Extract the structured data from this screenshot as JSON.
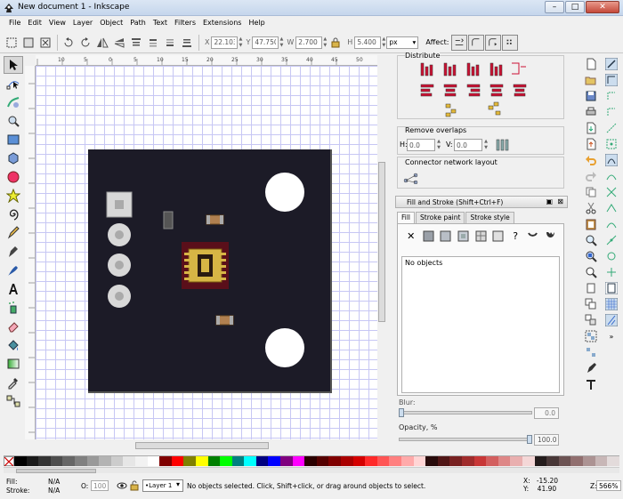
{
  "window": {
    "title": "New document 1 - Inkscape",
    "controls": [
      "–",
      "□",
      "✕"
    ]
  },
  "menu": [
    "File",
    "Edit",
    "View",
    "Layer",
    "Object",
    "Path",
    "Text",
    "Filters",
    "Extensions",
    "Help"
  ],
  "tool_controls": {
    "x_label": "X",
    "x_value": "22.103",
    "y_label": "Y",
    "y_value": "47.750",
    "w_label": "W",
    "w_value": "2.700",
    "h_label": "H",
    "h_value": "5.400",
    "unit": "px",
    "affect_label": "Affect:"
  },
  "ruler_labels": [
    "10",
    "5",
    "0",
    "5",
    "10",
    "15",
    "20",
    "25",
    "30",
    "35",
    "40",
    "45",
    "50"
  ],
  "dock": {
    "distribute_label": "Distribute",
    "remove_overlaps_label": "Remove overlaps",
    "h_label": "H:",
    "h_value": "0.0",
    "v_label": "V:",
    "v_value": "0.0",
    "connector_label": "Connector network layout",
    "fill_stroke_title": "Fill and Stroke (Shift+Ctrl+F)",
    "tabs": [
      "Fill",
      "Stroke paint",
      "Stroke style"
    ],
    "no_objects": "No objects",
    "blur_label": "Blur:",
    "blur_value": "0.0",
    "opacity_label": "Opacity, %",
    "opacity_value": "100.0"
  },
  "status": {
    "fill_label": "Fill:",
    "fill_value": "N/A",
    "stroke_label": "Stroke:",
    "stroke_value": "N/A",
    "o_label": "O:",
    "o_value": "100",
    "layer": "•Layer 1",
    "message": "No objects selected. Click, Shift+click, or drag around objects to select.",
    "x_label": "X:",
    "x_value": "-15.20",
    "y_label": "Y:",
    "y_value": "41.90",
    "z_label": "Z:",
    "zoom": "566%"
  },
  "palette_colors": [
    "#000000",
    "#1a1a1a",
    "#333333",
    "#4d4d4d",
    "#666666",
    "#808080",
    "#999999",
    "#b3b3b3",
    "#cccccc",
    "#e6e6e6",
    "#f2f2f2",
    "#ffffff",
    "#800000",
    "#ff0000",
    "#808000",
    "#ffff00",
    "#008000",
    "#00ff00",
    "#008080",
    "#00ffff",
    "#000080",
    "#0000ff",
    "#800080",
    "#ff00ff",
    "#2b0000",
    "#550000",
    "#800000",
    "#aa0000",
    "#d40000",
    "#ff2a2a",
    "#ff5555",
    "#ff8080",
    "#ffaaaa",
    "#ffd5d5",
    "#280b0b",
    "#501616",
    "#782121",
    "#a02c2c",
    "#c83737",
    "#d35f5f",
    "#de8787",
    "#e9afaf",
    "#f4d7d7",
    "#241c1c",
    "#483737",
    "#6c5353",
    "#916f6f",
    "#ac9393",
    "#c8b7b7",
    "#e3dbdb"
  ]
}
